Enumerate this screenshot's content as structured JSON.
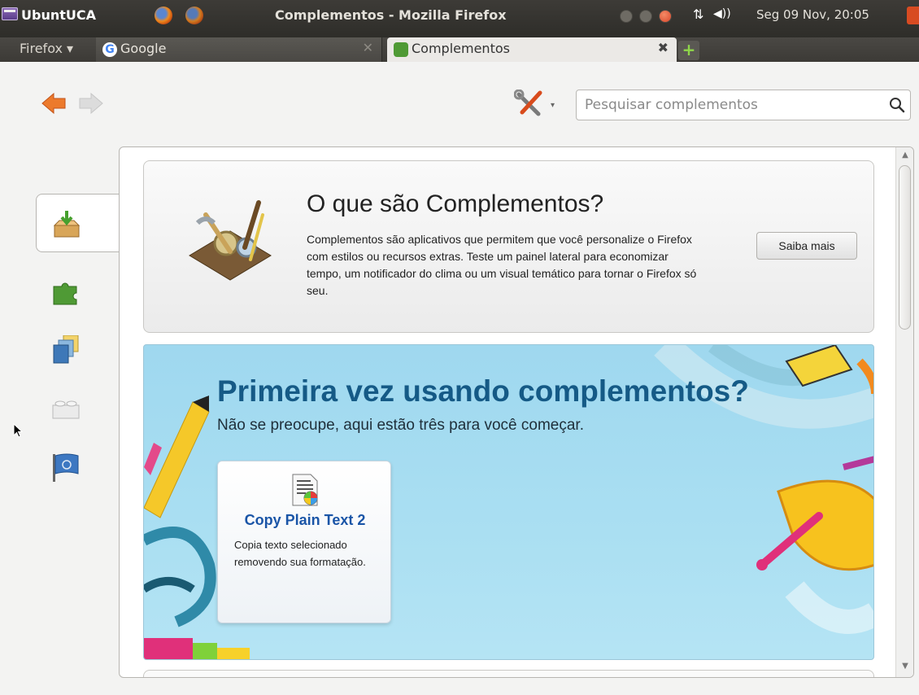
{
  "panel": {
    "app_name": "UbuntUCA",
    "window_title": "Complementos - Mozilla Firefox",
    "clock": "Seg 09 Nov, 20:05",
    "network_glyph": "⇅",
    "volume_glyph": "◀))"
  },
  "tabs": {
    "menu_label": "Firefox ▾",
    "google_favicon": "G",
    "items": [
      {
        "label": "Google",
        "active": false
      },
      {
        "label": "Complementos",
        "active": true
      }
    ],
    "close_glyph_inactive": "✕",
    "close_glyph_active": "✖",
    "new_tab_glyph": "+"
  },
  "toolbar": {
    "search_placeholder": "Pesquisar complementos",
    "tools_dropdown_glyph": "▾"
  },
  "categories": [
    {
      "name": "get-addons",
      "icon": "download-box-icon",
      "selected": true
    },
    {
      "name": "extensions",
      "icon": "puzzle-piece-icon",
      "selected": false
    },
    {
      "name": "appearance",
      "icon": "appearance-icon",
      "selected": false
    },
    {
      "name": "plugins",
      "icon": "lego-brick-icon",
      "selected": false
    },
    {
      "name": "languages",
      "icon": "flag-icon",
      "selected": false
    }
  ],
  "intro": {
    "title": "O que são Complementos?",
    "description": "Complementos são aplicativos que permitem que você personalize o Firefox com estilos ou recursos extras. Teste um painel lateral para economizar tempo, um notificador do clima ou um visual temático para tornar o Firefox só seu.",
    "button": "Saiba mais"
  },
  "first_time": {
    "title": "Primeira vez usando complementos?",
    "subtitle": "Não se preocupe, aqui estão três para você começar.",
    "recommendations": [
      {
        "name": "Copy Plain Text 2",
        "description": "Copia texto selecionado removendo sua formatação."
      }
    ]
  },
  "scrollbar": {
    "up_glyph": "▲",
    "down_glyph": "▼"
  },
  "colors": {
    "panel_bg": "#3d3b37",
    "title_blue": "#155a86",
    "addon_name_blue": "#1a55a7",
    "banner_bg": "#aadff2",
    "back_arrow": "#e8772e"
  }
}
